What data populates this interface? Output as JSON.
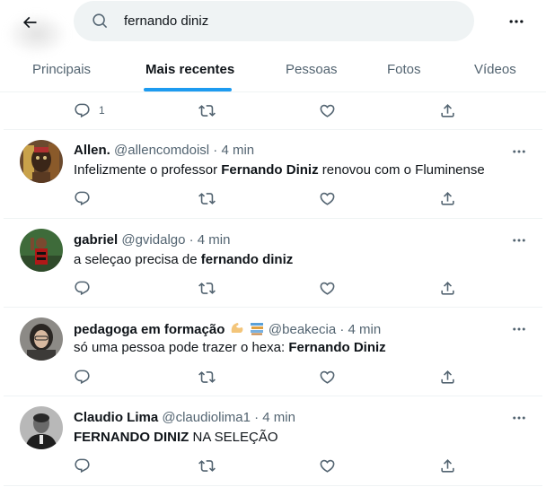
{
  "search": {
    "query": "fernando diniz"
  },
  "tabs": [
    "Principais",
    "Mais recentes",
    "Pessoas",
    "Fotos",
    "Vídeos"
  ],
  "active_tab": "Mais recentes",
  "colors": {
    "accent": "#1d9bf0",
    "text": "#0f1419",
    "muted": "#536471",
    "search_bg": "#eff3f4"
  },
  "first_row": {
    "reply_count": "1"
  },
  "tweets": [
    {
      "name": "Allen.",
      "meta": "@allencomdoisl · 4 min",
      "text_parts": [
        "Infelizmente o professor ",
        "Fernando Diniz",
        " renovou com o Fluminense"
      ]
    },
    {
      "name": "gabriel",
      "meta": "@gvidalgo · 4 min",
      "text_parts": [
        "a seleçao precisa de ",
        "fernando diniz",
        ""
      ]
    },
    {
      "name": "pedagoga em formação",
      "meta": "@beakecia · 4 min",
      "text_parts": [
        "só uma pessoa pode trazer o hexa: ",
        "Fernando Diniz",
        ""
      ]
    },
    {
      "name": "Claudio Lima",
      "meta": "@claudiolima1 · 4 min",
      "text_parts": [
        "",
        "FERNANDO DINIZ",
        " NA SELEÇÃO"
      ]
    }
  ],
  "icons": [
    "back-arrow-icon",
    "search-icon",
    "more-dots-icon",
    "reply-icon",
    "retweet-icon",
    "like-icon",
    "share-icon",
    "flexed-biceps-emoji",
    "books-emoji"
  ]
}
